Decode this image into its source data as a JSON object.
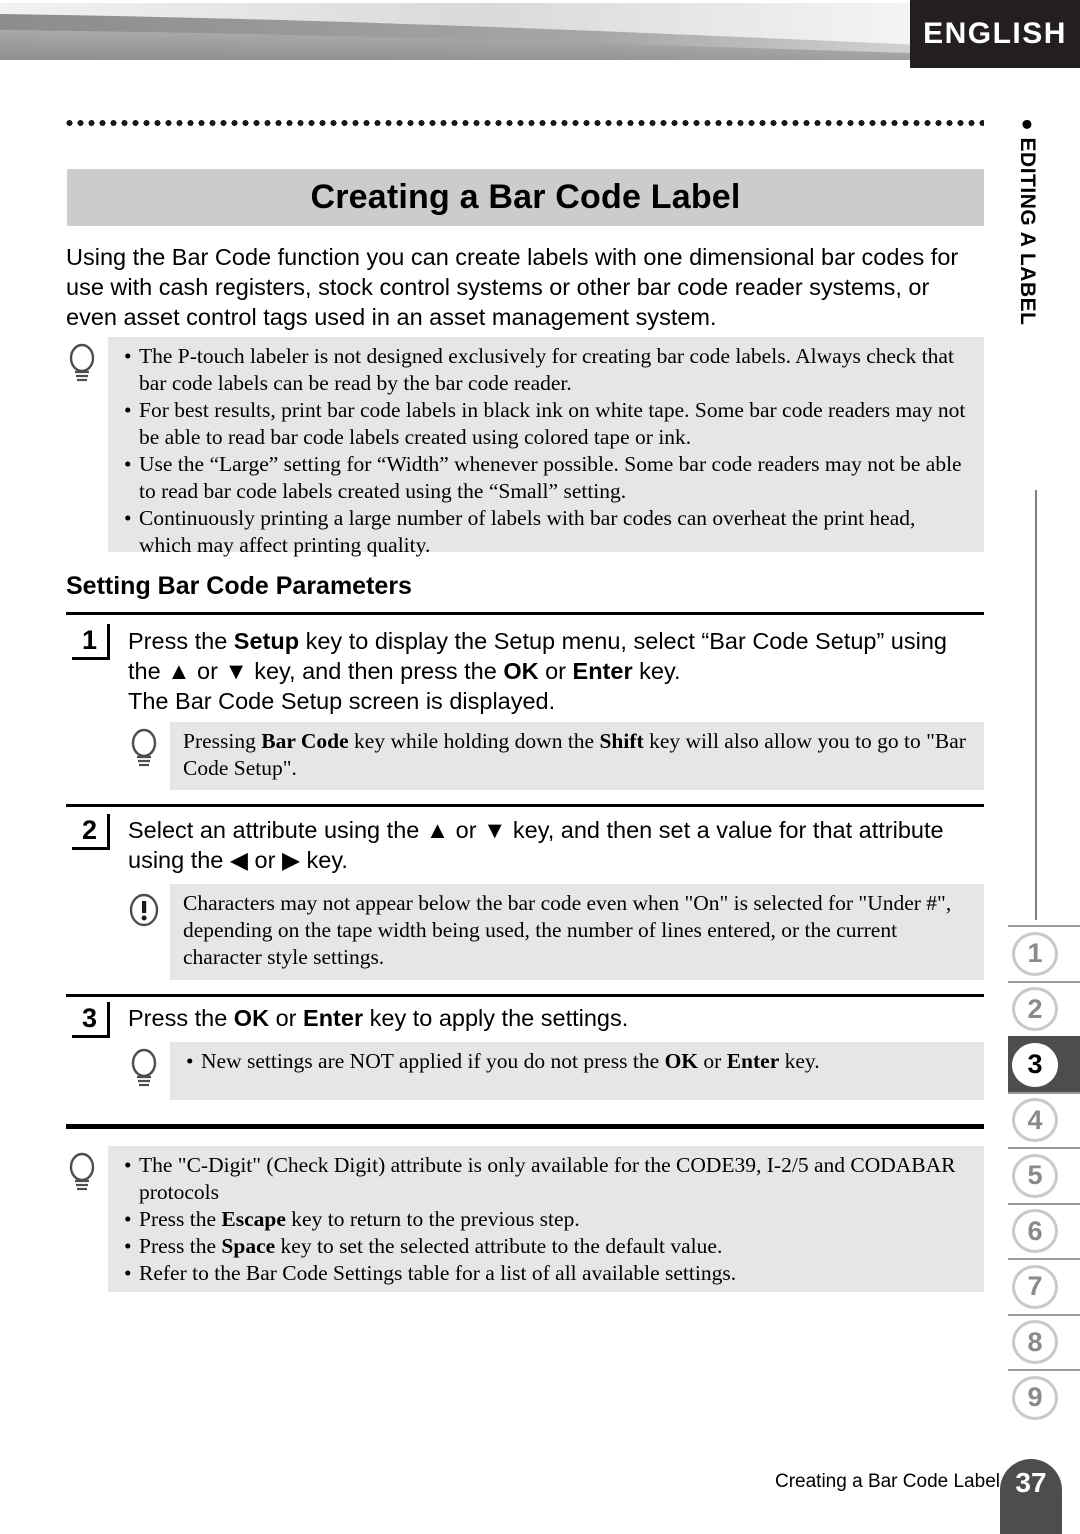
{
  "header": {
    "language_tab": "ENGLISH"
  },
  "side": {
    "chapter_label": "EDITING A LABEL",
    "bullet_glyph": "●"
  },
  "title": "Creating a Bar Code Label",
  "intro": "Using the Bar Code function you can create labels with one dimensional bar codes for use with cash registers, stock control systems or other bar code reader systems, or even asset control tags used in an asset management system.",
  "note_top": {
    "icon": "lightbulb-icon",
    "items": [
      "The P-touch labeler is not designed exclusively for creating bar code labels. Always check that bar code labels can be read by the bar code reader.",
      "For best results, print bar code labels in black ink on white tape. Some bar code readers may not be able to read bar code labels created using colored tape or ink.",
      "Use the “Large” setting for “Width” whenever possible. Some bar code readers may not be able to read bar code labels created using the “Small” setting.",
      "Continuously printing a large number of labels with bar codes can overheat the print head, which may affect printing quality."
    ]
  },
  "section_heading": "Setting Bar Code Parameters",
  "steps": [
    {
      "number": "1",
      "line1_a": "Press the ",
      "line1_b": "Setup",
      "line1_c": " key to display the Setup menu, select “Bar Code Setup” using the ",
      "up_arrow": "▲",
      "or_1": " or ",
      "down_arrow": "▼",
      "line1_d": " key, and then press the ",
      "ok": "OK",
      "or_2": " or ",
      "enter": "Enter",
      "line1_e": " key.",
      "line2": "The Bar Code Setup screen is displayed."
    },
    {
      "number": "2",
      "line1_a": "Select an attribute using the ",
      "up_arrow": "▲",
      "or_1": " or ",
      "down_arrow": "▼",
      "line1_b": " key, and then set a value for that attribute using the ",
      "left_arrow": "◀",
      "or_2": " or ",
      "right_arrow": "▶",
      "line1_c": " key."
    },
    {
      "number": "3",
      "line1_a": "Press the ",
      "ok": "OK",
      "or_1": " or ",
      "enter": "Enter",
      "line1_b": " key to apply the settings."
    }
  ],
  "note_step1": {
    "icon": "lightbulb-icon",
    "text_a": "Pressing ",
    "text_b": "Bar Code",
    "text_c": " key while holding down the ",
    "text_d": "Shift",
    "text_e": " key will also allow you to go to \"Bar Code Setup\"."
  },
  "note_step2": {
    "icon": "exclamation-icon",
    "text": "Characters may not appear below the bar code even when \"On\" is selected for \"Under #\", depending on the tape width being used, the number of lines entered, or the current character style settings."
  },
  "note_step3": {
    "icon": "lightbulb-icon",
    "text_a": "New settings are NOT applied if you do not press the ",
    "text_b": "OK",
    "text_c": " or ",
    "text_d": "Enter",
    "text_e": " key."
  },
  "note_bottom": {
    "icon": "lightbulb-icon",
    "item1": "The \"C-Digit\" (Check Digit) attribute is only available for the CODE39, I-2/5 and CODABAR protocols",
    "item2_a": "Press the ",
    "item2_b": "Escape",
    "item2_c": " key to return to the previous step.",
    "item3_a": "Press the ",
    "item3_b": "Space",
    "item3_c": " key to set the selected attribute to the default value.",
    "item4": "Refer to the Bar Code Settings table for a list of all available settings."
  },
  "tabs": [
    {
      "label": "1",
      "active": false
    },
    {
      "label": "2",
      "active": false
    },
    {
      "label": "3",
      "active": true
    },
    {
      "label": "4",
      "active": false
    },
    {
      "label": "5",
      "active": false
    },
    {
      "label": "6",
      "active": false
    },
    {
      "label": "7",
      "active": false
    },
    {
      "label": "8",
      "active": false
    },
    {
      "label": "9",
      "active": false
    }
  ],
  "footer": {
    "title": "Creating a Bar Code Label",
    "page_number": "37"
  },
  "colors": {
    "title_band": "#cccccc",
    "note_bg": "#e6e6e6",
    "dark": "#4d4d4d",
    "banner_dark": "#231f20"
  }
}
